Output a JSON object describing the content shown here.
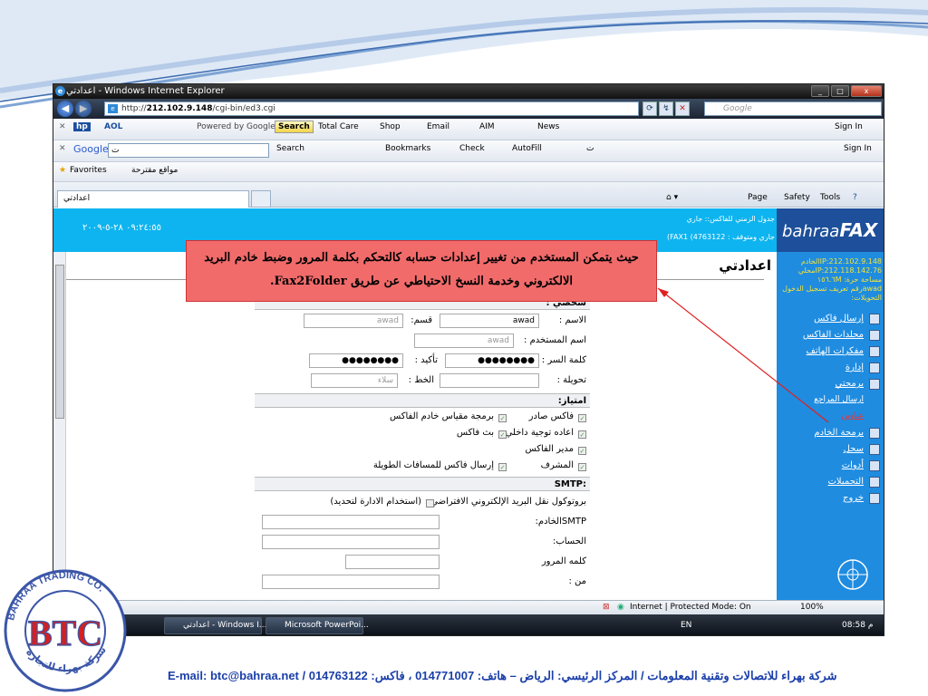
{
  "window": {
    "title": "اعدادتي - Windows Internet Explorer",
    "buttons": {
      "minimize": "_",
      "maximize": "□",
      "close": "x"
    }
  },
  "address_bar": {
    "url_prefix": "http://",
    "url_host": "212.102.9.148",
    "url_path": "/cgi-bin/ed3.cgi",
    "search_placeholder": "Google"
  },
  "toolbar_aol": {
    "aol": "AOL",
    "powered_by": "Powered by Google",
    "search": "Search",
    "total_care": "Total Care",
    "shop": "Shop",
    "email": "Email",
    "aim": "AIM",
    "news": "News",
    "sign_in": "Sign In"
  },
  "toolbar_google": {
    "google": "Google",
    "input_value": "ت",
    "search": "Search",
    "bookmarks": "Bookmarks",
    "check": "Check",
    "autofill": "AutoFill",
    "extra": "ت",
    "sign_in": "Sign In"
  },
  "favorites_bar": {
    "favorites": "Favorites",
    "suggested": "مواقع مقترحة"
  },
  "tab": {
    "label": "اعدادتي"
  },
  "command_bar": {
    "page": "Page",
    "safety": "Safety",
    "tools": "Tools"
  },
  "banner": {
    "datetime": "٠٩:٢٤:٥٥ ٢٨-٥-٢٠٠٩",
    "info1": "جدول الزمني للفاكس:: جاري",
    "info2": "(FAX1 (4763122 : جاري ومتوقف",
    "logo_light": "bahraa",
    "logo_bold": "FAX"
  },
  "sidebar": {
    "info": [
      "IP:212.102.9.148الخادم",
      "IP:212.118.142.76محلي",
      "مساحة حرة: ١٥٦.٦M",
      "awadرقم تعريف تسجيل الدخول",
      "التحويلات:"
    ],
    "items": [
      "إرسال فاكس",
      "مجلدات الفاكس",
      "مفكرات الهاتف",
      "إدارة",
      "برمجتي",
      "ارسال المراجع",
      "عناوين",
      "برمجة الخادم",
      "سجل",
      "أدوات",
      "التحميلات",
      "خروج"
    ]
  },
  "page": {
    "heading": "اعدادتي"
  },
  "form": {
    "sections": {
      "personal": "شخصي :",
      "privileges": "امتياز:",
      "smtp": "SMTP:"
    },
    "name_label": "الاسم :",
    "name_value": "awad",
    "dept_label": "قسم:",
    "dept_value": "awad",
    "username_label": "اسم المستخدم :",
    "username_value": "awad",
    "password_label": "كلمة السر :",
    "password_value": "●●●●●●●●",
    "confirm_label": "تأكيد :",
    "confirm_value": "●●●●●●●●",
    "forward_label": "تحويلة :",
    "line_label": "الخط :",
    "line_value": "سلاء",
    "privileges": [
      "فاكس صادر",
      "برمجة مقياس خادم الفاكس",
      "اعاده توجية داخلي",
      "بث فاكس",
      "مدير الفاكس",
      "المشرف",
      "إرسال فاكس للمسافات الطويلة"
    ],
    "smtp_protocol": "بروتوكول نقل البريد الإلكتروني الافتراضي :",
    "smtp_admin": "(استخدام الادارة لتحديد)",
    "smtp_server": "SMTPالخادم:",
    "smtp_account": "الحساب:",
    "smtp_password": "كلمه المرور",
    "smtp_from": "من :"
  },
  "status_bar": {
    "zone": "Internet | Protected Mode: On",
    "zoom": "100%"
  },
  "taskbar": {
    "item1": "اعدادتي - Windows I...",
    "item2": "Microsoft PowerPoi...",
    "lang": "EN",
    "clock": "08:58 م"
  },
  "callout": {
    "line1": "حيث يتمكن المستخدم من تغيير إعدادات حسابه كالتحكم بكلمة المرور وضبط خادم البريد",
    "line2": "الالكتروني وخدمة النسخ الاحتياطي عن طريق Fax2Folder."
  },
  "company_logo": {
    "letters": "BTC",
    "ring_top": "BAHRAA TRADING CO.",
    "ring_bottom": "شركة بهراء للتجارة"
  },
  "footer": {
    "text": "شركة بهراء للاتصالات وتقنية المعلومات / المركز الرئيسي: الرياض – هاتف: 014771007 ، فاكس: 014763122 / E-mail: btc@bahraa.net"
  }
}
